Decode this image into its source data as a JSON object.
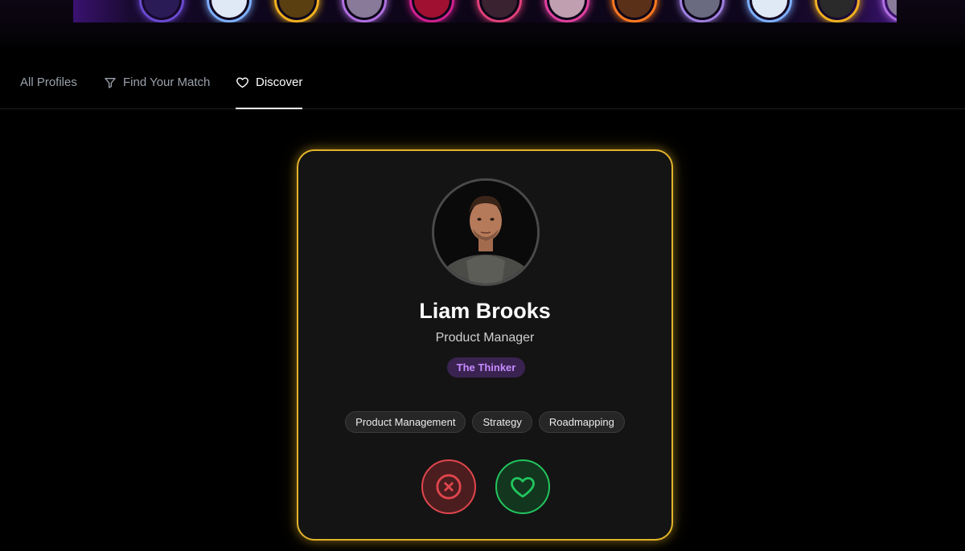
{
  "banner": {
    "avatars": [
      {
        "ring": "#6a4ad0",
        "fill": "#2a1a55"
      },
      {
        "ring": "#7fb0ff",
        "fill": "#dfe8f5"
      },
      {
        "ring": "#f0b020",
        "fill": "#5a4010"
      },
      {
        "ring": "#b070e0",
        "fill": "#8a7a9a"
      },
      {
        "ring": "#d02090",
        "fill": "#a01030"
      },
      {
        "ring": "#e0407a",
        "fill": "#3a2230"
      },
      {
        "ring": "#e040a0",
        "fill": "#c0a0b0"
      },
      {
        "ring": "#ff7a20",
        "fill": "#5a3018"
      },
      {
        "ring": "#a080e0",
        "fill": "#6a6a80"
      },
      {
        "ring": "#7fb0ff",
        "fill": "#dfe8f5"
      },
      {
        "ring": "#f0b020",
        "fill": "#2a2a2a"
      },
      {
        "ring": "#b070e0",
        "fill": "#8a7a9a"
      }
    ]
  },
  "tabs": [
    {
      "label": "All Profiles",
      "icon": "none",
      "active": false
    },
    {
      "label": "Find Your Match",
      "icon": "filter-icon",
      "active": false
    },
    {
      "label": "Discover",
      "icon": "heart-icon",
      "active": true
    }
  ],
  "profile": {
    "name": "Liam Brooks",
    "role": "Product Manager",
    "personality": "The Thinker",
    "skills": [
      "Product Management",
      "Strategy",
      "Roadmapping"
    ]
  },
  "actions": {
    "pass_icon": "x-circle-icon",
    "like_icon": "heart-icon"
  },
  "colors": {
    "card_border": "#e3b32a",
    "badge_text": "#c58bff",
    "pass": "#e0464d",
    "like": "#22c55e"
  }
}
